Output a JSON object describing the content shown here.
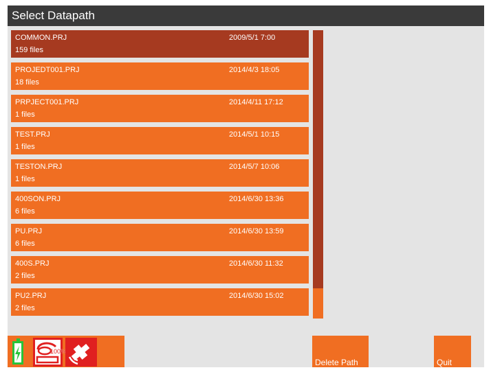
{
  "window": {
    "title": "Select Datapath"
  },
  "projects": [
    {
      "name": "COMMON.PRJ",
      "files": "159 files",
      "date": "2009/5/1 7:00",
      "selected": true
    },
    {
      "name": "PROJEDT001.PRJ",
      "files": "18 files",
      "date": "2014/4/3 18:05"
    },
    {
      "name": "PRPJECT001.PRJ",
      "files": "1 files",
      "date": "2014/4/11 17:12"
    },
    {
      "name": "TEST.PRJ",
      "files": "1 files",
      "date": "2014/5/1 10:15"
    },
    {
      "name": "TESTON.PRJ",
      "files": "1 files",
      "date": "2014/5/7 10:06"
    },
    {
      "name": "400SON.PRJ",
      "files": "6 files",
      "date": "2014/6/30 13:36"
    },
    {
      "name": "PU.PRJ",
      "files": "6 files",
      "date": "2014/6/30 13:59"
    },
    {
      "name": "400S.PRJ",
      "files": "2 files",
      "date": "2014/6/30 11:32"
    },
    {
      "name": "PU2.PRJ",
      "files": "2 files",
      "date": "2014/6/30 15:02"
    }
  ],
  "status": {
    "storage_label": "100%",
    "battery_icon": "battery-charging-icon",
    "storage_icon": "storage-disk-icon",
    "satellite_icon": "satellite-icon"
  },
  "buttons": {
    "delete_label": "Delete Path",
    "quit_label": "Quit"
  },
  "colors": {
    "accent": "#f06e22",
    "selected": "#a63a20",
    "titlebar": "#3a3a3a",
    "status_red": "#e02020",
    "battery_green": "#27c43a"
  }
}
